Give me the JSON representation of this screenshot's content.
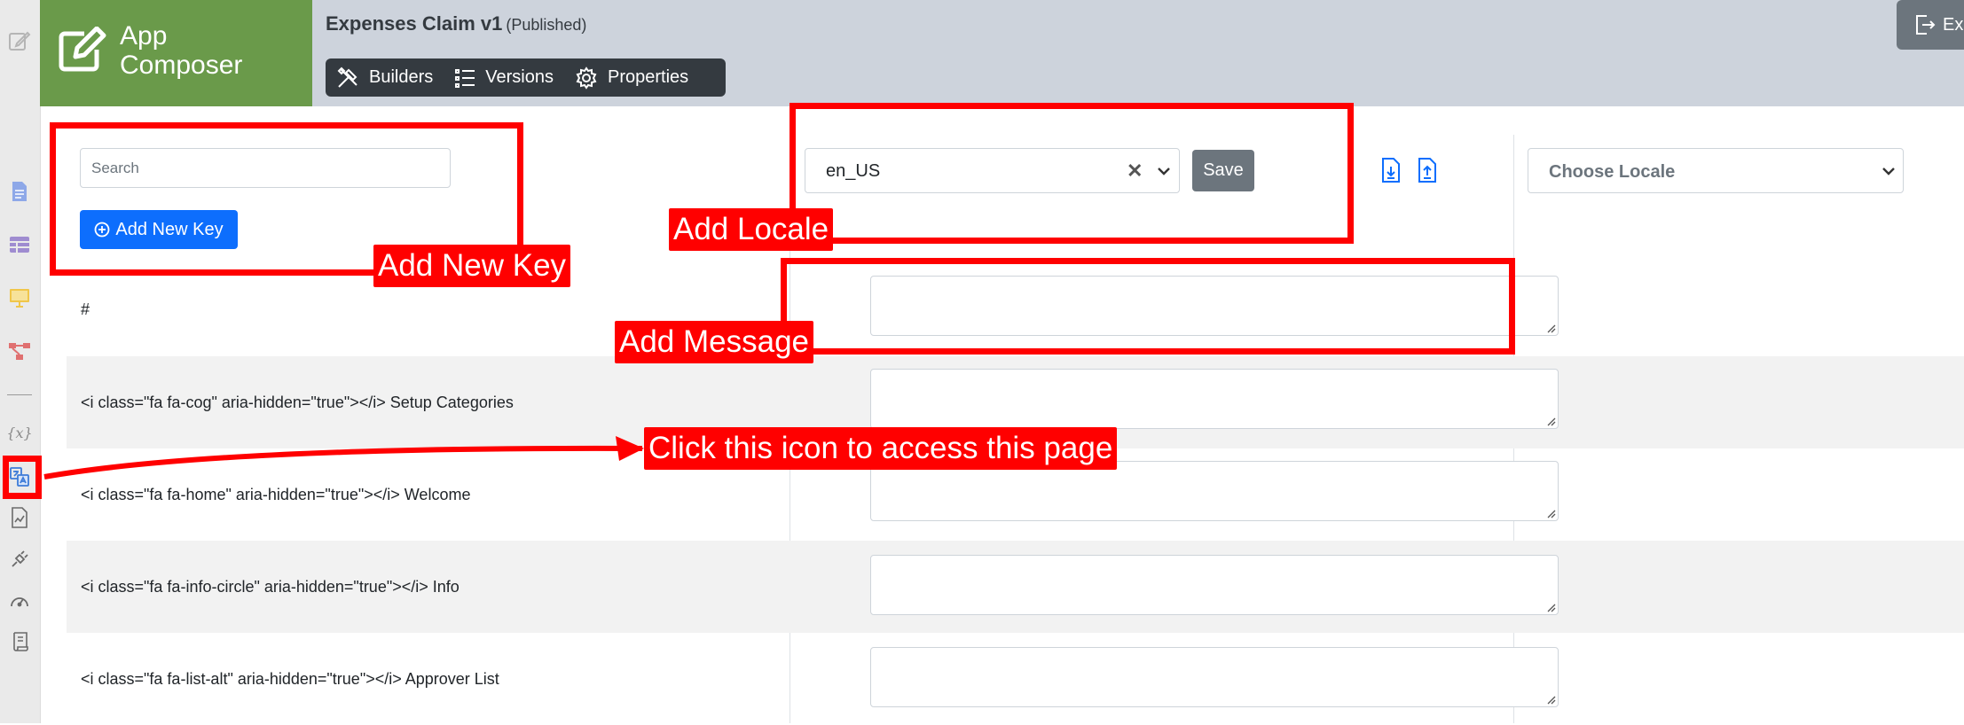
{
  "rail": {
    "icons": [
      "edit-icon",
      "file-icon",
      "table-icon",
      "monitor-icon",
      "workflow-icon",
      "variable-icon",
      "translate-icon",
      "report-icon",
      "plugin-icon",
      "dashboard-icon",
      "scroll-icon"
    ],
    "variable_glyph": "{x}"
  },
  "header": {
    "brand_line1": "App",
    "brand_line2": "Composer",
    "app_title": "Expenses Claim v1",
    "app_status": "(Published)",
    "tabs": [
      {
        "label": "Builders",
        "icon": "tools-icon"
      },
      {
        "label": "Versions",
        "icon": "list-icon"
      },
      {
        "label": "Properties",
        "icon": "gear-icon"
      }
    ],
    "exit_label": "Exit"
  },
  "toolbar": {
    "search_placeholder": "Search",
    "add_key_label": "Add New Key",
    "locale_value": "en_US",
    "clear_glyph": "✕",
    "save_label": "Save",
    "choose_locale_placeholder": "Choose Locale"
  },
  "table": {
    "header_key": "#",
    "rows": [
      {
        "key": "<i class=\"fa fa-cog\" aria-hidden=\"true\"></i> Setup Categories",
        "message": ""
      },
      {
        "key": "<i class=\"fa fa-home\" aria-hidden=\"true\"></i> Welcome",
        "message": ""
      },
      {
        "key": "<i class=\"fa fa-info-circle\" aria-hidden=\"true\"></i> Info",
        "message": ""
      },
      {
        "key": "<i class=\"fa fa-list-alt\" aria-hidden=\"true\"></i> Approver List",
        "message": ""
      }
    ]
  },
  "annotations": {
    "add_new_key": "Add New Key",
    "add_locale": "Add Locale",
    "add_message": "Add Message",
    "click_icon": "Click this icon to access this page",
    "color": "#ff0000"
  },
  "colors": {
    "brand": "#6a9a4a",
    "topbar": "#cdd3dc",
    "tabs_bg": "#343a40",
    "primary": "#0d6efd",
    "secondary": "#6c757d"
  }
}
